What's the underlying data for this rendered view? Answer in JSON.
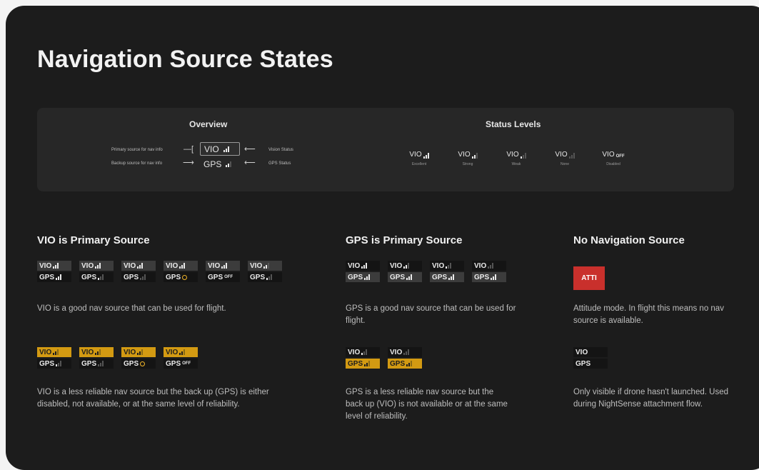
{
  "page": {
    "title": "Navigation Source States"
  },
  "overview": {
    "heading": "Overview",
    "primary_label": "Primary source for nav info",
    "backup_label": "Backup source for nav info",
    "vision_label": "Vision Status",
    "gps_status_label": "GPS Status",
    "vio_text": "VIO",
    "gps_text": "GPS"
  },
  "status_levels": {
    "heading": "Status Levels",
    "items": [
      {
        "text": "VIO",
        "sub": "Excellent",
        "bars": 3
      },
      {
        "text": "VIO",
        "sub": "Strong",
        "bars": 2
      },
      {
        "text": "VIO",
        "sub": "Weak",
        "bars": 1
      },
      {
        "text": "VIO",
        "sub": "None",
        "bars": 0
      },
      {
        "text": "VIO",
        "sub": "Disabled",
        "off": "OFF"
      }
    ]
  },
  "vio_primary": {
    "title": "VIO is Primary Source",
    "desc1": "VIO is a good nav source that can be used for flight.",
    "desc2": "VIO is a less reliable nav source but the back up (GPS) is either disabled, not available, or at the same level of reliability.",
    "row1": [
      {
        "top": "VIO",
        "top_bars": 3,
        "bottom": "GPS",
        "bottom_bars": 3
      },
      {
        "top": "VIO",
        "top_bars": 3,
        "bottom": "GPS",
        "bottom_bars": 1
      },
      {
        "top": "VIO",
        "top_bars": 3,
        "bottom": "GPS",
        "bottom_bars": 0
      },
      {
        "top": "VIO",
        "top_bars": 3,
        "bottom": "GPS",
        "bottom_icon": "circle"
      },
      {
        "top": "VIO",
        "top_bars": 3,
        "bottom": "GPS",
        "bottom_off": "OFF"
      },
      {
        "top": "VIO",
        "top_bars": 2,
        "bottom": "GPS",
        "bottom_bars": 1
      }
    ],
    "row2": [
      {
        "top": "VIO",
        "top_bars": 2,
        "bottom": "GPS",
        "bottom_bars": 1
      },
      {
        "top": "VIO",
        "top_bars": 2,
        "bottom": "GPS",
        "bottom_bars": 0
      },
      {
        "top": "VIO",
        "top_bars": 2,
        "bottom": "GPS",
        "bottom_icon": "circle"
      },
      {
        "top": "VIO",
        "top_bars": 2,
        "bottom": "GPS",
        "bottom_off": "OFF"
      }
    ]
  },
  "gps_primary": {
    "title": "GPS is Primary Source",
    "desc1": "GPS is a good nav source that can be used for flight.",
    "desc2": "GPS is a less reliable nav source but the back up (VIO) is not available or at the same level of reliability.",
    "row1": [
      {
        "top": "VIO",
        "top_bars": 3,
        "bottom": "GPS",
        "bottom_bars": 3
      },
      {
        "top": "VIO",
        "top_bars": 2,
        "bottom": "GPS",
        "bottom_bars": 3
      },
      {
        "top": "VIO",
        "top_bars": 1,
        "bottom": "GPS",
        "bottom_bars": 3
      },
      {
        "top": "VIO",
        "top_bars": 0,
        "bottom": "GPS",
        "bottom_bars": 3
      }
    ],
    "row2": [
      {
        "top": "VIO",
        "top_bars": 1,
        "bottom": "GPS",
        "bottom_bars": 2
      },
      {
        "top": "VIO",
        "top_bars": 0,
        "bottom": "GPS",
        "bottom_bars": 2
      }
    ]
  },
  "no_nav": {
    "title": "No Navigation Source",
    "atti_label": "ATTI",
    "desc1": "Attitude mode. In flight this means no nav source is available.",
    "desc2": "Only visible if drone hasn't launched. Used during NightSense attachment flow.",
    "vio_text": "VIO",
    "gps_text": "GPS"
  },
  "colors": {
    "panel_bg": "#1c1c1c",
    "amber": "#d39a12",
    "atti_red": "#c9302c",
    "gps_circle": "#f0b429"
  }
}
